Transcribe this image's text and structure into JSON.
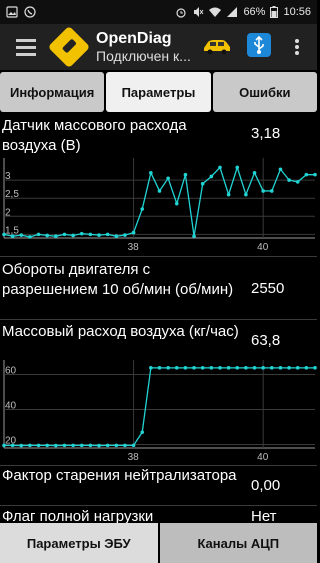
{
  "status_bar": {
    "battery": "66%",
    "time": "10:56"
  },
  "app": {
    "title": "OpenDiag",
    "subtitle": "Подключен к..."
  },
  "tabs": [
    {
      "label": "Информация",
      "active": false
    },
    {
      "label": "Параметры",
      "active": true
    },
    {
      "label": "Ошибки",
      "active": false
    }
  ],
  "params": [
    {
      "name": "Датчик массового расхода воздуха (В)",
      "value": "3,18"
    },
    {
      "name": "Обороты двигателя с разрешением 10 об/мин (об/мин)",
      "value": "2550"
    },
    {
      "name": "Массовый расход воздуха (кг/час)",
      "value": "63,8"
    },
    {
      "name": "Фактор старения нейтрализатора",
      "value": "0,00"
    },
    {
      "name": "Флаг полной нагрузки",
      "value": "Нет"
    }
  ],
  "chart_data": [
    {
      "type": "line",
      "series": [
        {
          "values": [
            1.5,
            1.45,
            1.48,
            1.43,
            1.5,
            1.47,
            1.45,
            1.5,
            1.47,
            1.52,
            1.5,
            1.48,
            1.5,
            1.45,
            1.48,
            1.55,
            2.2,
            3.2,
            2.7,
            3.05,
            2.35,
            3.15,
            1.45,
            2.9,
            3.1,
            3.35,
            2.6,
            3.35,
            2.6,
            3.2,
            2.7,
            2.7,
            3.3,
            3.0,
            2.95,
            3.15,
            3.15
          ]
        }
      ],
      "xticks": [
        {
          "label": "38",
          "index": 15
        },
        {
          "label": "40",
          "index": 30
        }
      ],
      "yticks": [
        "1,5",
        "2",
        "2,5",
        "3"
      ],
      "ylim": [
        1.4,
        3.5
      ]
    },
    {
      "type": "line",
      "series": [
        {
          "values": [
            19.5,
            19.5,
            19.4,
            19.5,
            19.5,
            19.5,
            19.4,
            19.5,
            19.5,
            19.5,
            19.5,
            19.4,
            19.5,
            19.5,
            19.5,
            19.5,
            27,
            63.8,
            63.8,
            63.8,
            63.8,
            63.8,
            63.8,
            63.8,
            63.8,
            63.8,
            63.8,
            63.8,
            63.8,
            63.8,
            63.8,
            63.8,
            63.8,
            63.8,
            63.8,
            63.8,
            63.8
          ]
        }
      ],
      "xticks": [
        {
          "label": "38",
          "index": 15
        },
        {
          "label": "40",
          "index": 30
        }
      ],
      "yticks": [
        "20",
        "40",
        "60"
      ],
      "ylim": [
        18,
        66
      ]
    }
  ],
  "bottom_bar": {
    "ecu_label": "Параметры ЭБУ",
    "adc_label": "Каналы АЦП"
  }
}
